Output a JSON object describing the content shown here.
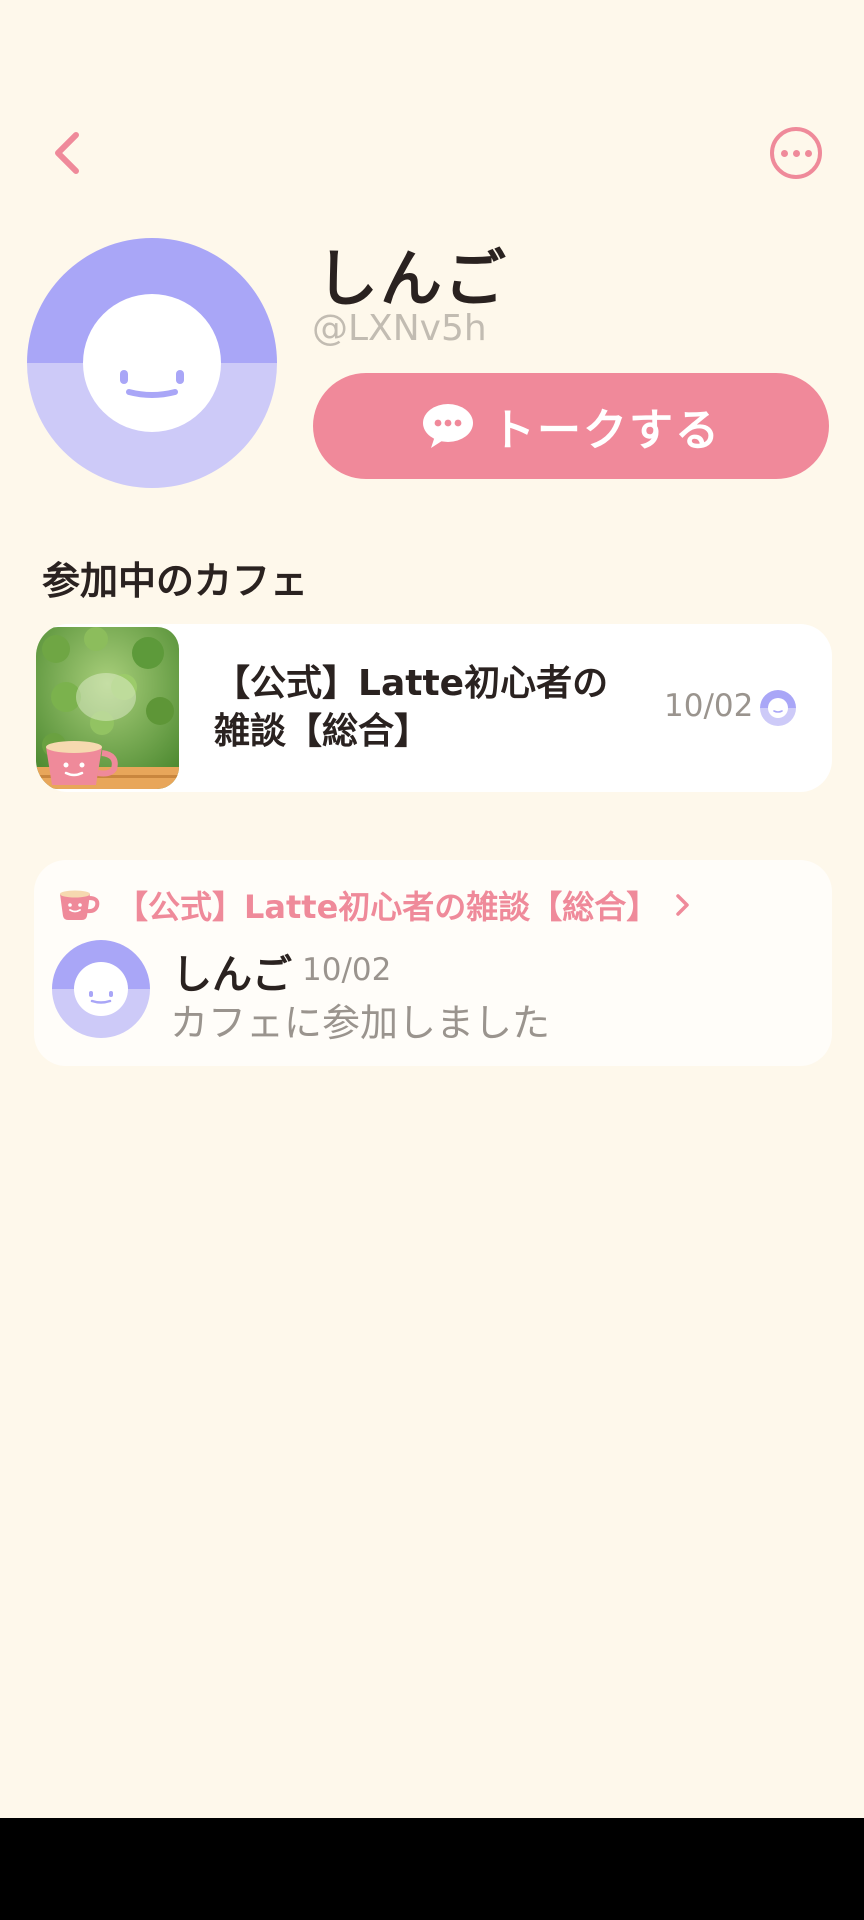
{
  "header": {
    "back_icon": "chevron-left-icon",
    "more_icon": "ellipsis-icon",
    "accent_color": "#ef8a9a"
  },
  "profile": {
    "name": "しんご",
    "handle": "@LXNv5h",
    "avatar_colors": {
      "top": "#a9a6f7",
      "bottom": "#cdcaf8",
      "face": "#ffffff"
    },
    "talk_button": {
      "label": "トークする",
      "icon": "chat-bubble-icon",
      "color": "#f0899a"
    }
  },
  "cafes_section": {
    "title": "参加中のカフェ",
    "items": [
      {
        "title": "【公式】Latte初心者の雑談【総合】",
        "date": "10/02",
        "thumbnail": "cafe-thumbnail-greenery-cup"
      }
    ]
  },
  "activity": {
    "cafe_icon": "coffee-cup-icon",
    "cafe_name": "【公式】Latte初心者の雑談【総合】",
    "user_name": "しんご",
    "date": "10/02",
    "message": "カフェに参加しました"
  }
}
